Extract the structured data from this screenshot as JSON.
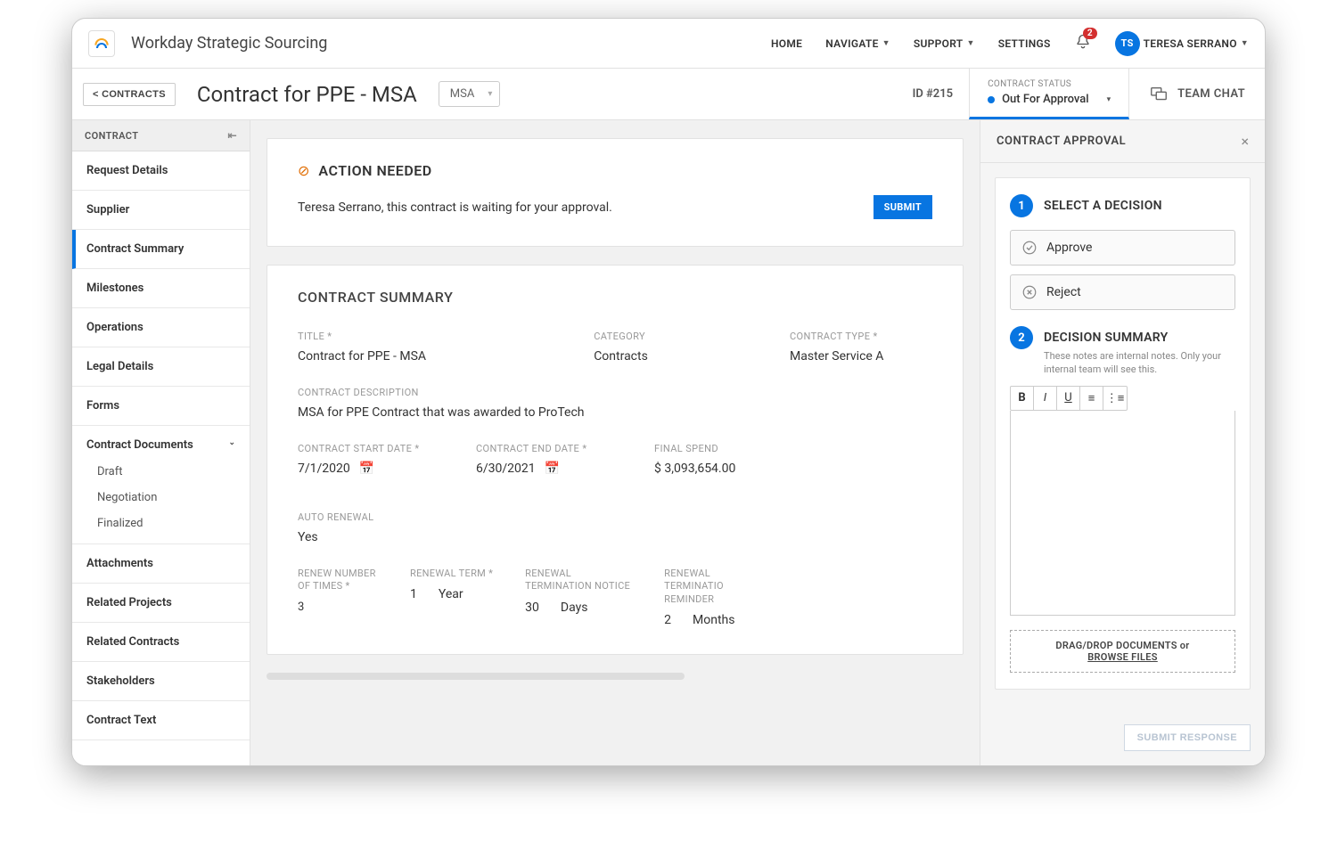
{
  "brand": "Workday Strategic Sourcing",
  "topnav": {
    "home": "HOME",
    "navigate": "NAVIGATE",
    "support": "SUPPORT",
    "settings": "SETTINGS",
    "notifications_count": "2",
    "user_initials": "TS",
    "user_name": "TERESA SERRANO"
  },
  "subbar": {
    "back_label": "< CONTRACTS",
    "title": "Contract for PPE - MSA",
    "type_select": "MSA",
    "id_label": "ID #215",
    "status_caption": "CONTRACT STATUS",
    "status_text": "Out For Approval",
    "team_chat": "TEAM CHAT"
  },
  "sidebar": {
    "head": "CONTRACT",
    "items": [
      "Request Details",
      "Supplier",
      "Contract Summary",
      "Milestones",
      "Operations",
      "Legal Details",
      "Forms"
    ],
    "docs_label": "Contract Documents",
    "docs": [
      "Draft",
      "Negotiation",
      "Finalized"
    ],
    "tail": [
      "Attachments",
      "Related Projects",
      "Related Contracts",
      "Stakeholders",
      "Contract Text"
    ],
    "active_index": 2
  },
  "action": {
    "heading": "ACTION NEEDED",
    "message": "Teresa Serrano, this contract is waiting for your approval.",
    "submit_label": "SUBMIT"
  },
  "summary": {
    "heading": "CONTRACT SUMMARY",
    "title_label": "TITLE *",
    "title_value": "Contract for PPE - MSA",
    "category_label": "CATEGORY",
    "category_value": "Contracts",
    "type_label": "CONTRACT TYPE *",
    "type_value": "Master Service A",
    "desc_label": "CONTRACT DESCRIPTION",
    "desc_value": "MSA for PPE Contract that was awarded to ProTech",
    "start_label": "CONTRACT START DATE *",
    "start_value": "7/1/2020",
    "end_label": "CONTRACT END DATE *",
    "end_value": "6/30/2021",
    "spend_label": "FINAL SPEND",
    "spend_value": "$ 3,093,654.00",
    "auto_label": "AUTO RENEWAL",
    "auto_value": "Yes",
    "renew_times_label": "RENEW NUMBER OF TIMES *",
    "renew_times_value": "3",
    "renew_term_label": "RENEWAL TERM *",
    "renew_term_num": "1",
    "renew_term_unit": "Year",
    "renew_notice_label": "RENEWAL TERMINATION NOTICE",
    "renew_notice_num": "30",
    "renew_notice_unit": "Days",
    "renew_reminder_label": "RENEWAL TERMINATIO REMINDER",
    "renew_reminder_num": "2",
    "renew_reminder_unit": "Months"
  },
  "approval": {
    "panel_title": "CONTRACT APPROVAL",
    "step1_label": "SELECT A DECISION",
    "approve": "Approve",
    "reject": "Reject",
    "step2_label": "DECISION SUMMARY",
    "step2_note": "These notes are internal notes. Only your internal team will see this.",
    "dropzone_a": "DRAG/DROP DOCUMENTS or",
    "dropzone_b": "BROWSE FILES",
    "submit_response": "SUBMIT RESPONSE"
  }
}
